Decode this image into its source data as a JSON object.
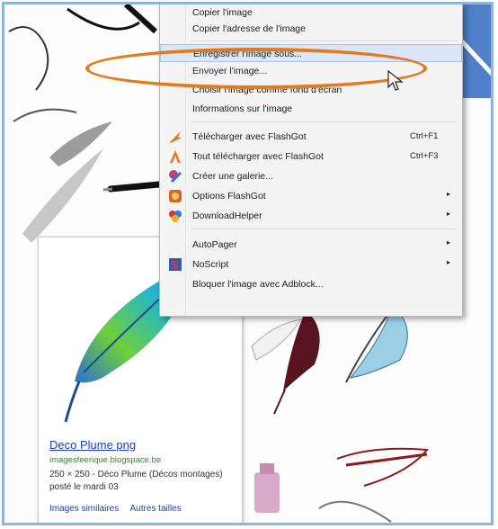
{
  "context_menu": {
    "items": [
      {
        "label": "Copier l'image"
      },
      {
        "label": "Copier l'adresse de l'image"
      },
      {
        "label": "Enregistrer l'image sous..."
      },
      {
        "label": "Envoyer l'image..."
      },
      {
        "label": "Choisir l'image comme fond d'écran"
      },
      {
        "label": "Informations sur l'image"
      },
      {
        "label": "Télécharger avec FlashGot",
        "shortcut": "Ctrl+F1"
      },
      {
        "label": "Tout télécharger avec FlashGot",
        "shortcut": "Ctrl+F3"
      },
      {
        "label": "Créer une galerie..."
      },
      {
        "label": "Options FlashGot"
      },
      {
        "label": "DownloadHelper"
      },
      {
        "label": "AutoPager"
      },
      {
        "label": "NoScript"
      },
      {
        "label": "Bloquer l'image avec Adblock..."
      }
    ],
    "submenu_arrow": "▸"
  },
  "result_card": {
    "title": "Deco Plume png",
    "source": "imagesfeerique.blogspace.be",
    "description": "250 × 250 - Déco Plume (Décos montages) posté le mardi 03",
    "link_similar": "Images similaires",
    "link_sizes": "Autres tailles"
  },
  "colors": {
    "highlight_ellipse": "#e27a1e",
    "menu_background": "#f4f4f4",
    "link_color": "#1a3fbf",
    "source_color": "#2a8a2a"
  },
  "icons": [
    "flashgot-icon",
    "flashgot-all-icon",
    "gallery-icon",
    "flashgot-options-icon",
    "downloadhelper-icon",
    "noscript-icon",
    "cursor-arrow-icon",
    "feather-icon"
  ]
}
